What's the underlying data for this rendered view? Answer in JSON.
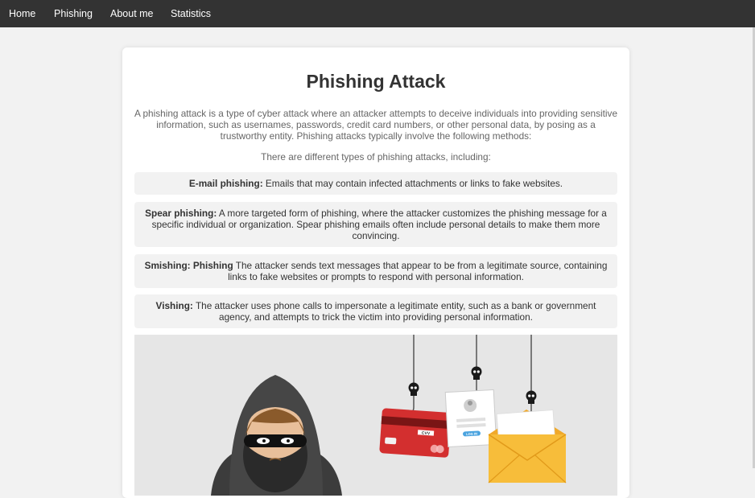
{
  "nav": {
    "items": [
      {
        "label": "Home"
      },
      {
        "label": "Phishing"
      },
      {
        "label": "About me"
      },
      {
        "label": "Statistics"
      }
    ]
  },
  "main": {
    "title": "Phishing Attack",
    "intro": "A phishing attack is a type of cyber attack where an attacker attempts to deceive individuals into providing sensitive information, such as usernames, passwords, credit card numbers, or other personal data, by posing as a trustworthy entity. Phishing attacks typically involve the following methods:",
    "types_intro": "There are different types of phishing attacks, including:",
    "methods": [
      {
        "name": "E-mail phishing:",
        "description": " Emails that may contain infected attachments or links to fake websites."
      },
      {
        "name": "Spear phishing:",
        "description": " A more targeted form of phishing, where the attacker customizes the phishing message for a specific individual or organization. Spear phishing emails often include personal details to make them more convincing."
      },
      {
        "name": "Smishing: Phishing",
        "description": " The attacker sends text messages that appear to be from a legitimate source, containing links to fake websites or prompts to respond with personal information."
      },
      {
        "name": "Vishing:",
        "description": " The attacker uses phone calls to impersonate a legitimate entity, such as a bank or government agency, and attempts to trick the victim into providing personal information."
      }
    ],
    "illustration": {
      "card_code_label": "CVV",
      "login_button_label": "LOG IN"
    }
  },
  "colors": {
    "navbar": "#333333",
    "page_background": "#f2f2f2",
    "card_red": "#d32f2f",
    "envelope_yellow": "#f7bd3a"
  }
}
